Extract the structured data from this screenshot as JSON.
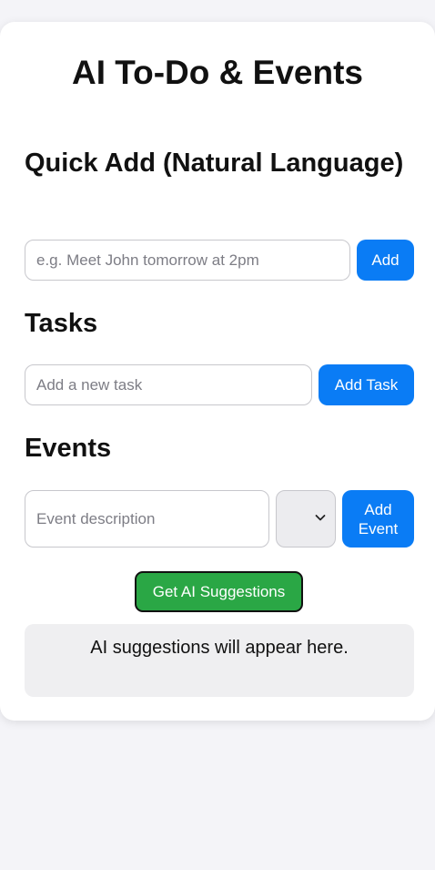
{
  "app": {
    "title": "AI To-Do & Events"
  },
  "quick_add": {
    "heading": "Quick Add (Natural Language)",
    "input_value": "",
    "placeholder": "e.g. Meet John tomorrow at 2pm",
    "button_label": "Add"
  },
  "tasks": {
    "heading": "Tasks",
    "input_value": "",
    "placeholder": "Add a new task",
    "button_label": "Add Task"
  },
  "events": {
    "heading": "Events",
    "input_value": "",
    "placeholder": "Event description",
    "select_value": "",
    "button_label": "Add Event"
  },
  "ai": {
    "button_label": "Get AI Suggestions",
    "output_text": "AI suggestions will appear here."
  },
  "icons": {
    "select_chevron": "chevron-down-icon"
  },
  "colors": {
    "primary_button": "#0a7cf5",
    "ai_button": "#2aa745",
    "page_background": "#f4f4f8",
    "card_background": "#ffffff",
    "suggestions_background": "#efeff1"
  }
}
